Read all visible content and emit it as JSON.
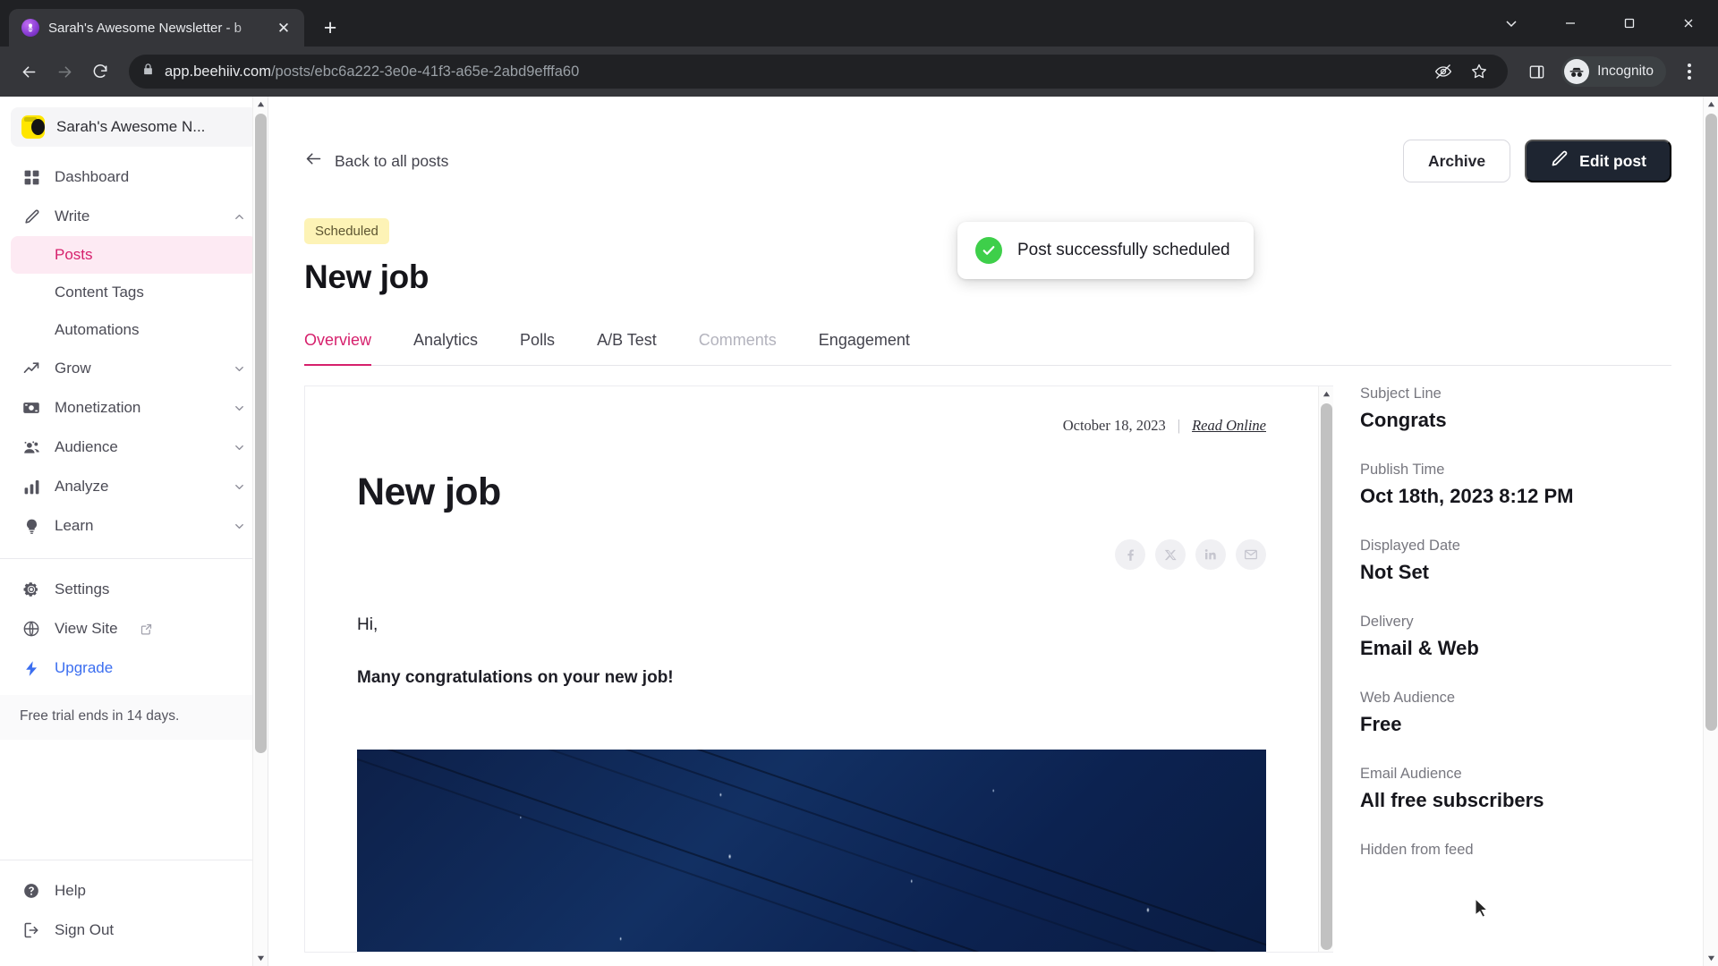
{
  "browser": {
    "tab": {
      "title": "Sarah's Awesome Newsletter - b",
      "favicon": "beehiiv-favicon-icon",
      "close_label": "✕",
      "new_tab_label": "+"
    },
    "window_controls": {
      "minimize_extra": "chevron-down",
      "minimize": "minimize",
      "maximize": "maximize",
      "close": "close"
    },
    "toolbar": {
      "back": "back-arrow",
      "forward": "forward-arrow",
      "reload": "reload",
      "lock": "lock-icon",
      "url_domain": "app.beehiiv.com",
      "url_path": "/posts/ebc6a222-3e0e-41f3-a65e-2abd9efffa60",
      "url_full": "app.beehiiv.com/posts/ebc6a222-3e0e-41f3-a65e-2abd9efffa60",
      "tracking_protection": "eye-slash-icon",
      "bookmark": "star-icon",
      "side_panel": "side-panel-icon",
      "profile_label": "Incognito",
      "menu": "kebab-menu-icon"
    }
  },
  "sidebar": {
    "publication": "Sarah's Awesome N...",
    "items": [
      {
        "label": "Dashboard",
        "icon": "grid-icon",
        "chevron": ""
      },
      {
        "label": "Write",
        "icon": "pencil-icon",
        "chevron": "up"
      },
      {
        "label": "Posts",
        "icon": "",
        "chevron": ""
      },
      {
        "label": "Content Tags",
        "icon": "",
        "chevron": ""
      },
      {
        "label": "Automations",
        "icon": "",
        "chevron": ""
      },
      {
        "label": "Grow",
        "icon": "trend-up-icon",
        "chevron": "down"
      },
      {
        "label": "Monetization",
        "icon": "money-icon",
        "chevron": "down"
      },
      {
        "label": "Audience",
        "icon": "people-icon",
        "chevron": "down"
      },
      {
        "label": "Analyze",
        "icon": "bar-chart-icon",
        "chevron": "down"
      },
      {
        "label": "Learn",
        "icon": "lightbulb-icon",
        "chevron": "down"
      }
    ],
    "settings": "Settings",
    "view_site": "View Site",
    "upgrade": "Upgrade",
    "trial_notice": "Free trial ends in 14 days.",
    "help": "Help",
    "sign_out": "Sign Out"
  },
  "header": {
    "back_label": "Back to all posts",
    "archive_label": "Archive",
    "edit_label": "Edit post",
    "status_badge": "Scheduled",
    "title": "New job"
  },
  "toast": {
    "message": "Post successfully scheduled",
    "icon": "check-circle-icon"
  },
  "tabs": [
    {
      "label": "Overview",
      "state": "active"
    },
    {
      "label": "Analytics",
      "state": "normal"
    },
    {
      "label": "Polls",
      "state": "normal"
    },
    {
      "label": "A/B Test",
      "state": "normal"
    },
    {
      "label": "Comments",
      "state": "disabled"
    },
    {
      "label": "Engagement",
      "state": "normal"
    }
  ],
  "preview": {
    "date": "October 18, 2023",
    "separator": "|",
    "read_online": "Read Online",
    "heading": "New job",
    "socials": [
      "facebook-icon",
      "x-twitter-icon",
      "linkedin-icon",
      "email-icon"
    ],
    "greeting": "Hi,",
    "body": "Many congratulations on your new job!",
    "image_alt": "night-sky-photo"
  },
  "info_panel": {
    "fields": [
      {
        "label": "Subject Line",
        "value": "Congrats"
      },
      {
        "label": "Publish Time",
        "value": "Oct 18th, 2023 8:12 PM"
      },
      {
        "label": "Displayed Date",
        "value": "Not Set"
      },
      {
        "label": "Delivery",
        "value": "Email & Web"
      },
      {
        "label": "Web Audience",
        "value": "Free"
      },
      {
        "label": "Email Audience",
        "value": "All free subscribers"
      },
      {
        "label": "Hidden from feed",
        "value": ""
      }
    ]
  },
  "colors": {
    "accent_pink": "#d6206c",
    "badge_yellow": "#fdf3b6",
    "toast_green": "#3ecf4a",
    "upgrade_blue": "#3b6ef0",
    "dark_button": "#1e2531"
  }
}
